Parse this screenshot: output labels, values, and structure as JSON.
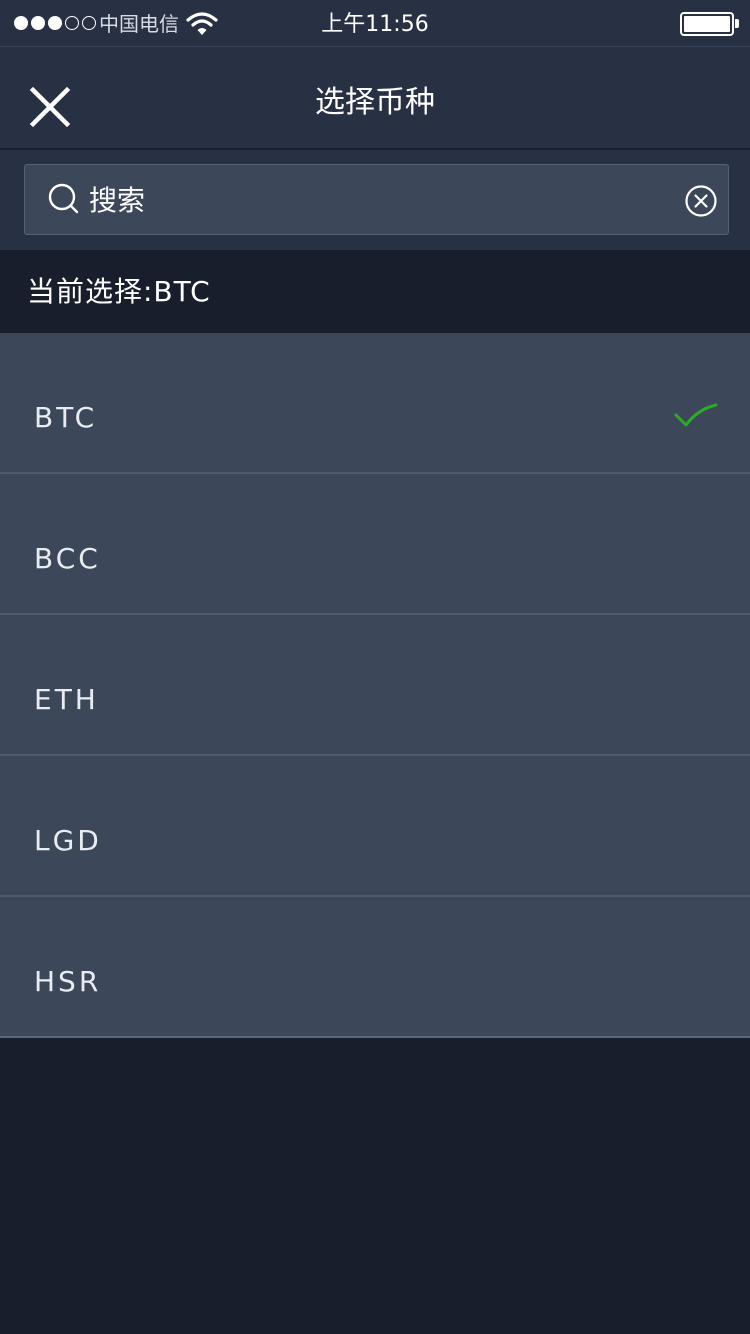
{
  "status_bar": {
    "carrier": "中国电信",
    "time": "上午11:56",
    "signal_filled": 3,
    "signal_total": 5
  },
  "nav": {
    "title": "选择币种"
  },
  "search": {
    "placeholder": "搜索",
    "value": ""
  },
  "current_selection": {
    "text": "当前选择:BTC"
  },
  "coins": [
    {
      "label": "BTC",
      "selected": true
    },
    {
      "label": "BCC",
      "selected": false
    },
    {
      "label": "ETH",
      "selected": false
    },
    {
      "label": "LGD",
      "selected": false
    },
    {
      "label": "HSR",
      "selected": false
    }
  ],
  "colors": {
    "background": "#181e2b",
    "bar": "#283043",
    "row": "#3c475a",
    "check": "#2eaa2a"
  },
  "icons": [
    "close-icon",
    "search-icon",
    "clear-icon",
    "checkmark-icon",
    "wifi-icon",
    "battery-icon"
  ]
}
